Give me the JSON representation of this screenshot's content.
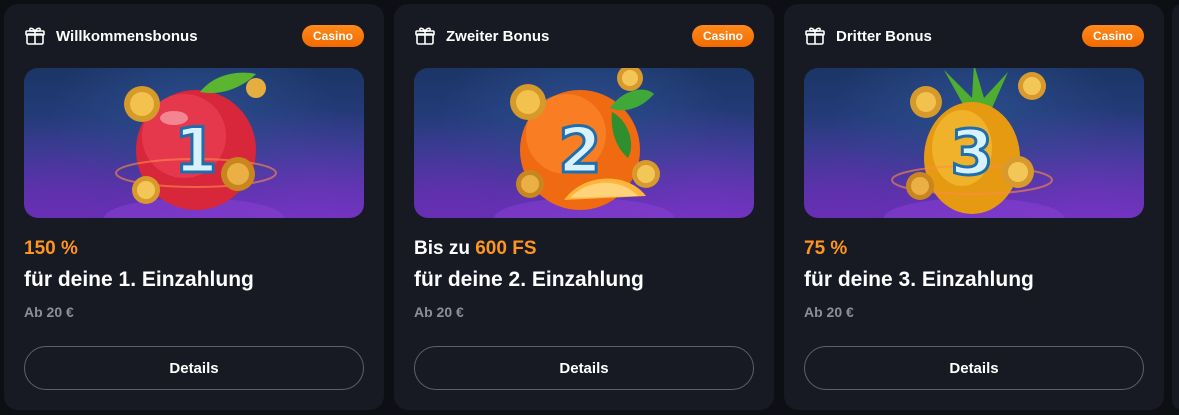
{
  "cards": [
    {
      "title": "Willkommensbonus",
      "badge": "Casino",
      "amount_prefix": "",
      "amount_value": "150 %",
      "subtitle": "für deine 1. Einzahlung",
      "minimum": "Ab 20 €",
      "button": "Details",
      "banner_number": "1",
      "fruit": "apple-icon"
    },
    {
      "title": "Zweiter Bonus",
      "badge": "Casino",
      "amount_prefix": "Bis zu ",
      "amount_value": "600 FS",
      "subtitle": "für deine 2. Einzahlung",
      "minimum": "Ab 20 €",
      "button": "Details",
      "banner_number": "2",
      "fruit": "orange-icon"
    },
    {
      "title": "Dritter Bonus",
      "badge": "Casino",
      "amount_prefix": "",
      "amount_value": "75 %",
      "subtitle": "für deine 3. Einzahlung",
      "minimum": "Ab 20 €",
      "button": "Details",
      "banner_number": "3",
      "fruit": "pineapple-icon"
    }
  ],
  "colors": {
    "accent": "#ff951f",
    "badge": "#f57a10",
    "card_bg": "#171a22",
    "page_bg": "#0d0f15"
  }
}
